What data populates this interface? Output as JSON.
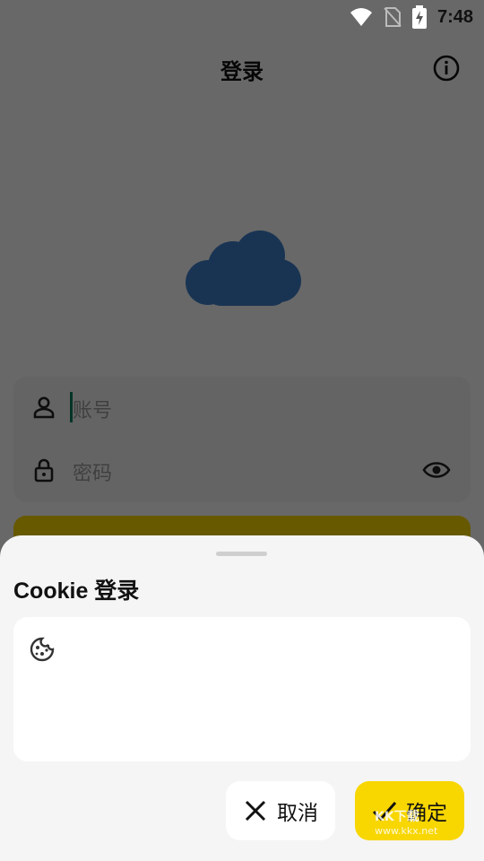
{
  "status_bar": {
    "time": "7:48",
    "icons": [
      "wifi-icon",
      "no-sim-icon",
      "battery-charging-icon"
    ]
  },
  "app_bar": {
    "title": "登录",
    "info_icon": "info-icon"
  },
  "login_form": {
    "account_placeholder": "账号",
    "password_placeholder": "密码",
    "icons": [
      "person-icon",
      "lock-icon",
      "eye-icon"
    ]
  },
  "sheet": {
    "title": "Cookie 登录",
    "input_icon": "cookie-icon",
    "cancel_label": "取消",
    "confirm_label": "确定"
  },
  "watermark": {
    "text": "KK下载",
    "url": "www.kkx.net"
  },
  "colors": {
    "accent": "#f8d600",
    "cloud": "#3d7cc6",
    "scrim": "rgba(0,0,0,0.58)"
  }
}
